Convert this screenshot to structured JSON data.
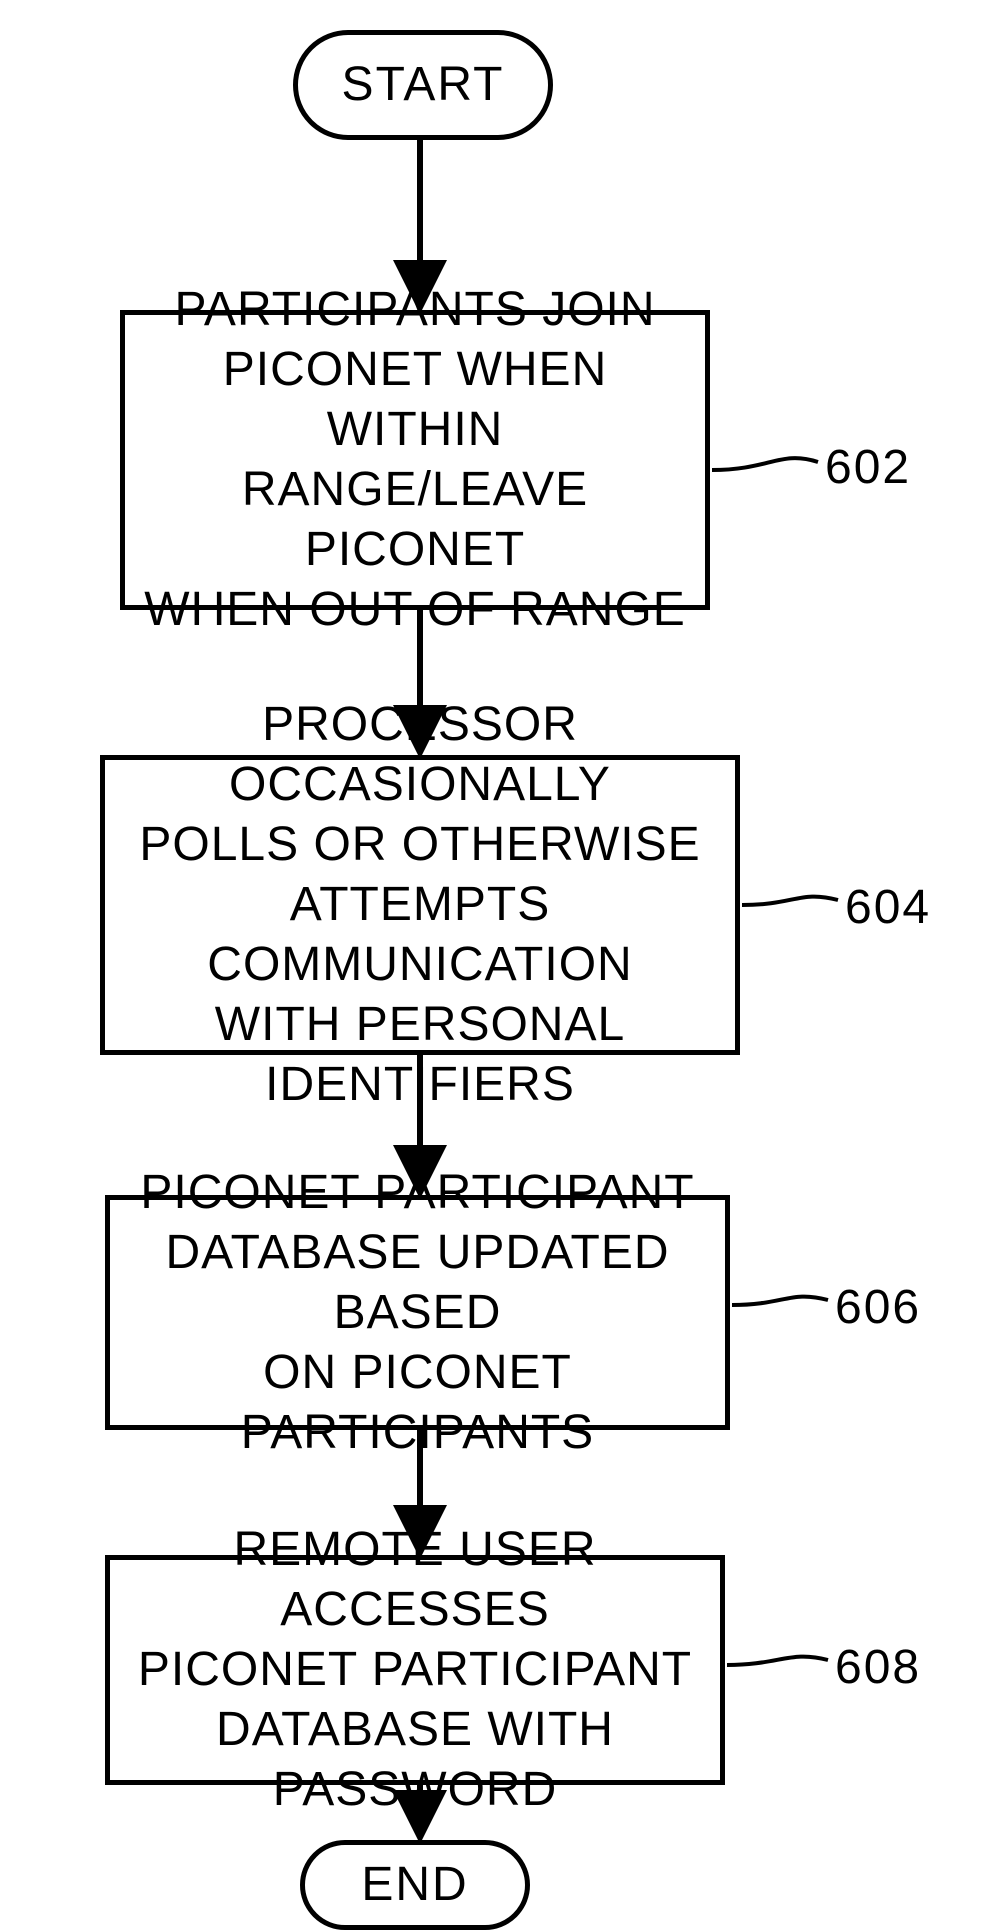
{
  "chart_data": {
    "type": "flowchart",
    "nodes": [
      {
        "id": "start",
        "kind": "terminator",
        "label": "START"
      },
      {
        "id": "n602",
        "kind": "process",
        "label": "PARTICIPANTS JOIN PICONET WHEN WITHIN RANGE/LEAVE PICONET WHEN OUT OF RANGE",
        "ref": "602"
      },
      {
        "id": "n604",
        "kind": "process",
        "label": "PROCESSOR OCCASIONALLY POLLS OR OTHERWISE ATTEMPTS COMMUNICATION WITH PERSONAL IDENTIFIERS",
        "ref": "604"
      },
      {
        "id": "n606",
        "kind": "process",
        "label": "PICONET PARTICIPANT DATABASE UPDATED BASED ON PICONET PARTICIPANTS",
        "ref": "606"
      },
      {
        "id": "n608",
        "kind": "process",
        "label": "REMOTE USER ACCESSES PICONET PARTICIPANT DATABASE WITH PASSWORD",
        "ref": "608"
      },
      {
        "id": "end",
        "kind": "terminator",
        "label": "END"
      }
    ],
    "edges": [
      {
        "from": "start",
        "to": "n602"
      },
      {
        "from": "n602",
        "to": "n604"
      },
      {
        "from": "n604",
        "to": "n606"
      },
      {
        "from": "n606",
        "to": "n608"
      },
      {
        "from": "n608",
        "to": "end"
      }
    ]
  },
  "terminators": {
    "start": "START",
    "end": "END"
  },
  "steps": {
    "s602": {
      "text": "PARTICIPANTS JOIN\nPICONET WHEN WITHIN\nRANGE/LEAVE PICONET\nWHEN OUT OF RANGE",
      "ref": "602"
    },
    "s604": {
      "text": "PROCESSOR OCCASIONALLY\nPOLLS OR OTHERWISE\nATTEMPTS COMMUNICATION\nWITH PERSONAL IDENTIFIERS",
      "ref": "604"
    },
    "s606": {
      "text": "PICONET PARTICIPANT\nDATABASE UPDATED BASED\nON PICONET PARTICIPANTS",
      "ref": "606"
    },
    "s608": {
      "text": "REMOTE USER ACCESSES\nPICONET PARTICIPANT\nDATABASE WITH PASSWORD",
      "ref": "608"
    }
  }
}
